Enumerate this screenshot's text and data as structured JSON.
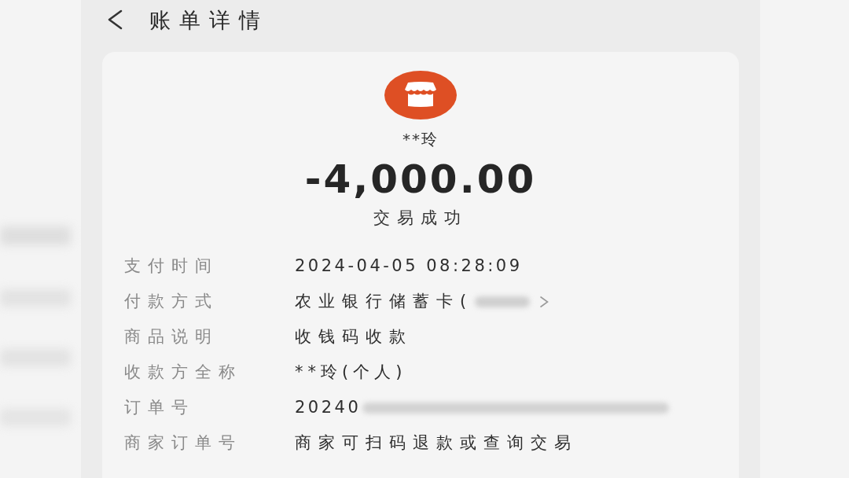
{
  "header": {
    "title": "账单详情"
  },
  "payee": {
    "name": "**玲"
  },
  "amount": "-4,000.00",
  "status": "交易成功",
  "details": [
    {
      "label": "支付时间",
      "value": "2024-04-05 08:28:09",
      "redacted": false,
      "chevron": false
    },
    {
      "label": "付款方式",
      "value": "农业银行储蓄卡(",
      "redacted": true,
      "chevron": true
    },
    {
      "label": "商品说明",
      "value": "收钱码收款",
      "redacted": false,
      "chevron": false
    },
    {
      "label": "收款方全称",
      "value": "**玲(个人)",
      "redacted": false,
      "chevron": false
    },
    {
      "label": "订单号",
      "value": "20240",
      "redacted": true,
      "chevron": false
    },
    {
      "label": "商家订单号",
      "value": "商家可扫码退款或查询交易",
      "redacted": false,
      "chevron": false
    }
  ]
}
